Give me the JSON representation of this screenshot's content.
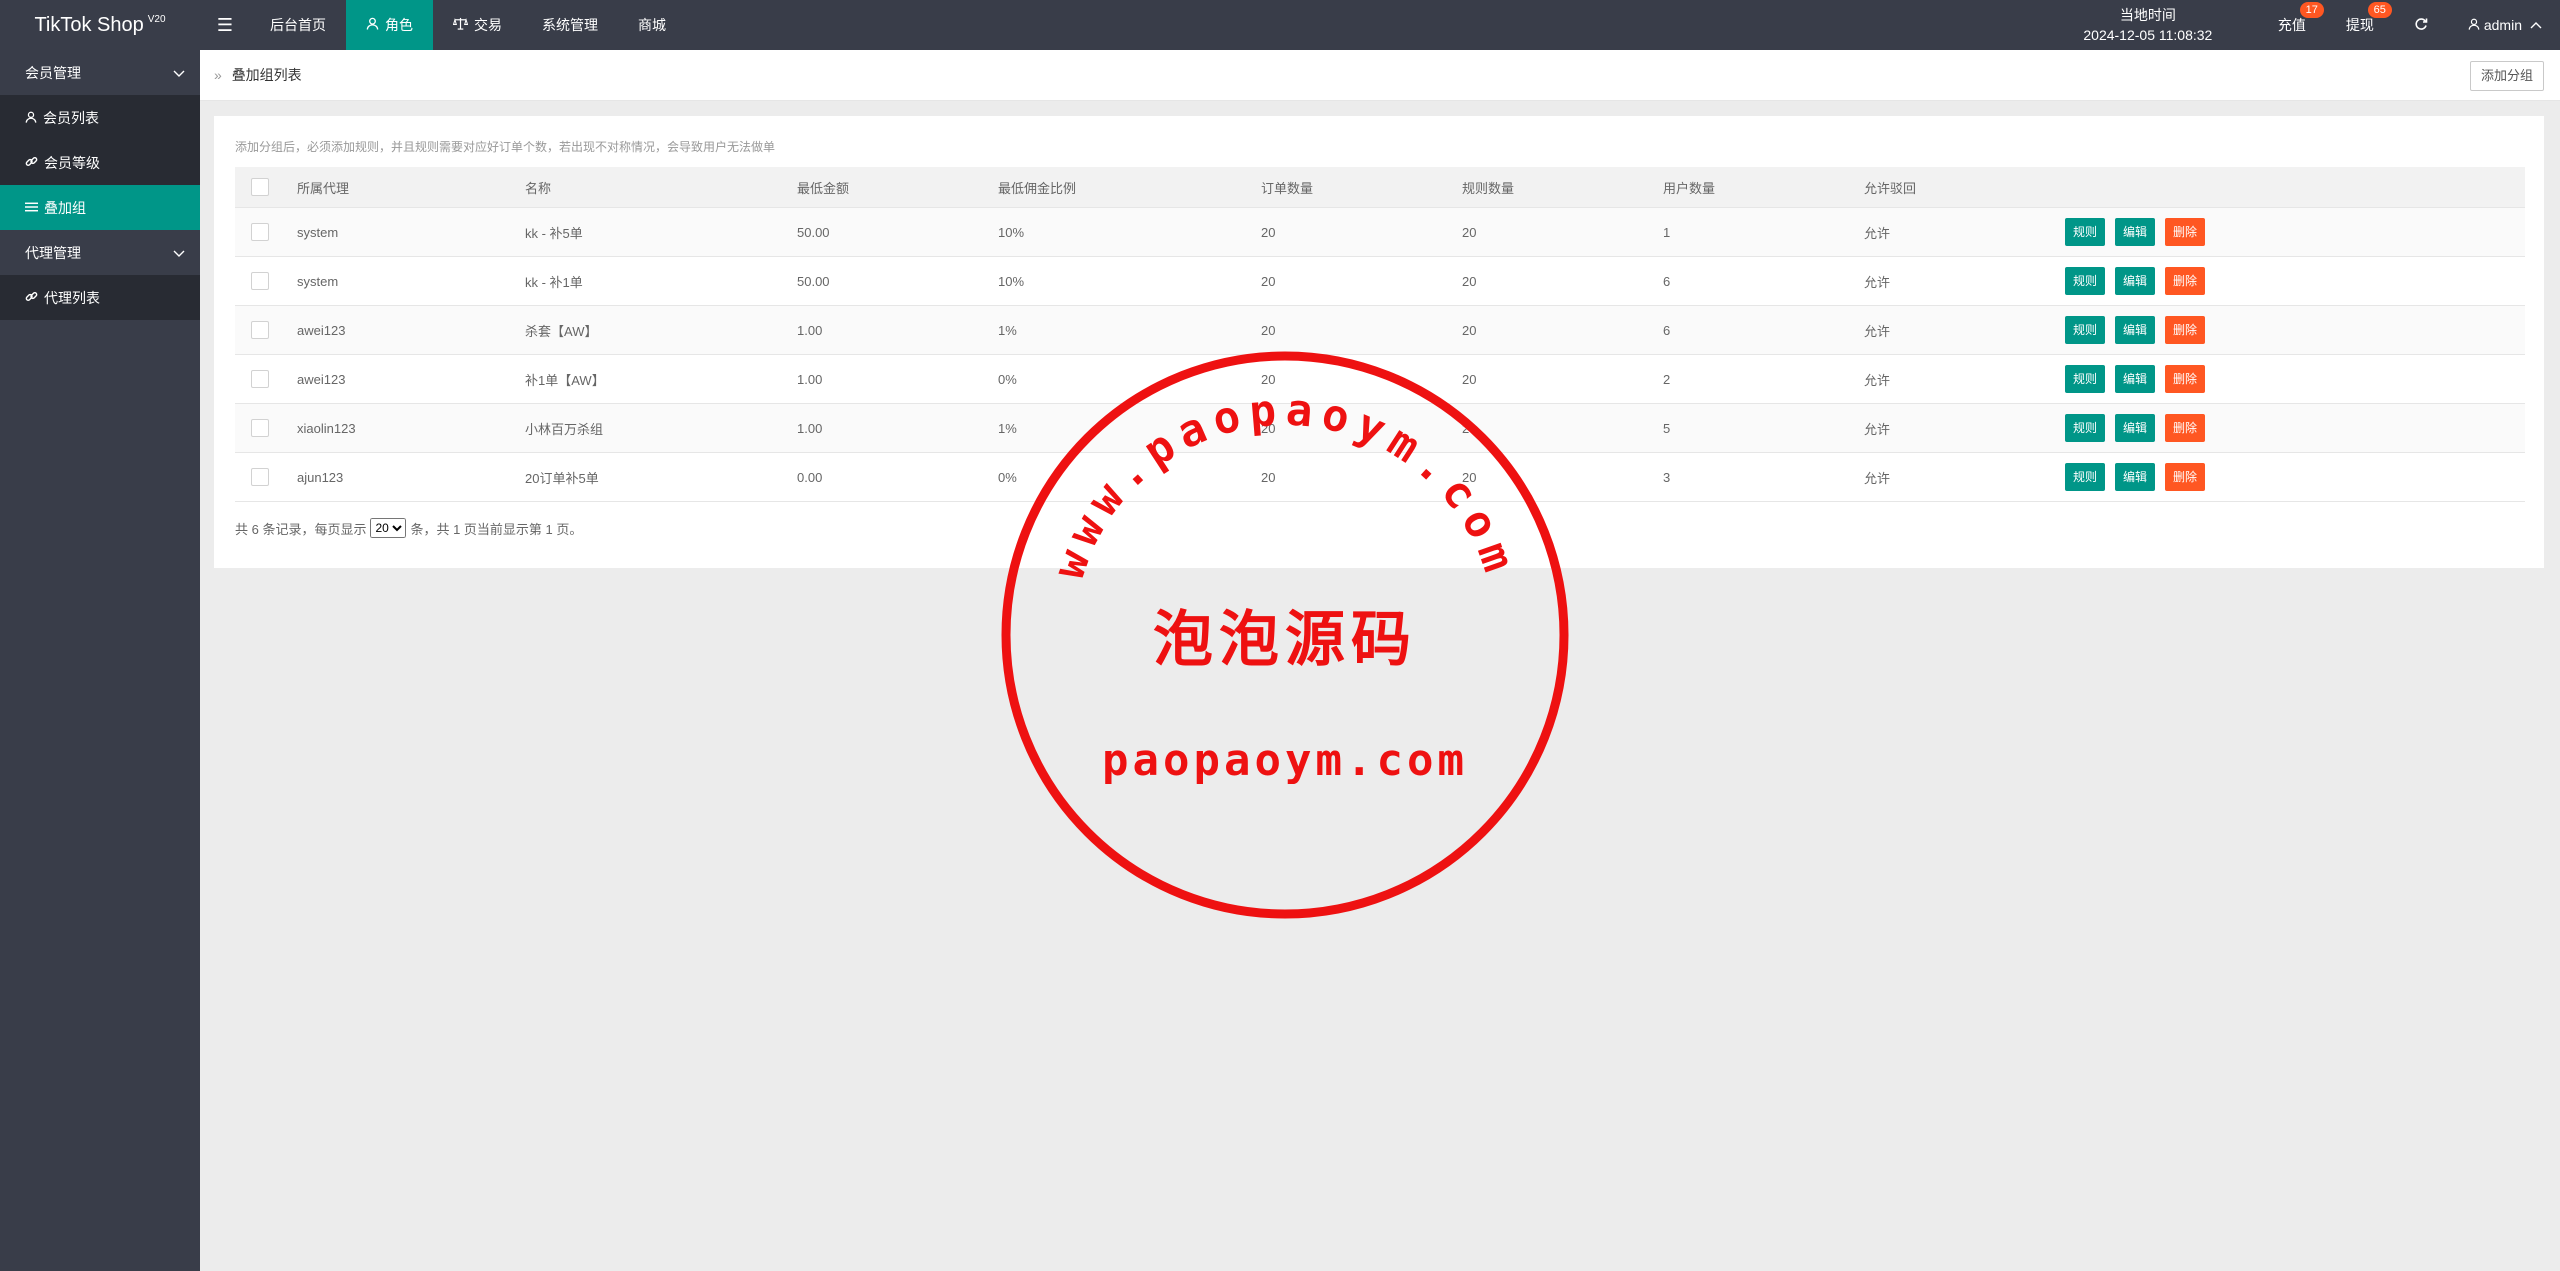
{
  "app": {
    "logo": "TikTok Shop",
    "version": "V20"
  },
  "nav": {
    "items": [
      {
        "label": "后台首页",
        "icon": "",
        "active": false
      },
      {
        "label": "角色",
        "icon": "user-icon",
        "active": true
      },
      {
        "label": "交易",
        "icon": "scale-icon",
        "active": false
      },
      {
        "label": "系统管理",
        "icon": "",
        "active": false
      },
      {
        "label": "商城",
        "icon": "",
        "active": false
      }
    ]
  },
  "header": {
    "time_label": "当地时间",
    "time_value": "2024-12-05 11:08:32",
    "recharge": {
      "label": "充值",
      "badge": "17"
    },
    "withdraw": {
      "label": "提现",
      "badge": "65"
    },
    "user": "admin"
  },
  "sidebar": {
    "groups": [
      {
        "label": "会员管理",
        "children": [
          {
            "label": "会员列表",
            "icon": "user-icon",
            "active": false
          },
          {
            "label": "会员等级",
            "icon": "link-icon",
            "active": false
          },
          {
            "label": "叠加组",
            "icon": "list-icon",
            "active": true
          }
        ]
      },
      {
        "label": "代理管理",
        "children": [
          {
            "label": "代理列表",
            "icon": "link-icon",
            "active": false
          }
        ]
      }
    ]
  },
  "page": {
    "breadcrumb": "叠加组列表",
    "add_button": "添加分组",
    "tip": "添加分组后，必须添加规则，并且规则需要对应好订单个数，若出现不对称情况，会导致用户无法做单"
  },
  "table": {
    "headers": [
      "所属代理",
      "名称",
      "最低金额",
      "最低佣金比例",
      "订单数量",
      "规则数量",
      "用户数量",
      "允许驳回"
    ],
    "rows": [
      [
        "system",
        "kk - 补5单",
        "50.00",
        "10%",
        "20",
        "20",
        "1",
        "允许"
      ],
      [
        "system",
        "kk - 补1单",
        "50.00",
        "10%",
        "20",
        "20",
        "6",
        "允许"
      ],
      [
        "awei123",
        "杀套【AW】",
        "1.00",
        "1%",
        "20",
        "20",
        "6",
        "允许"
      ],
      [
        "awei123",
        "补1单【AW】",
        "1.00",
        "0%",
        "20",
        "20",
        "2",
        "允许"
      ],
      [
        "xiaolin123",
        "小林百万杀组",
        "1.00",
        "1%",
        "20",
        "20",
        "5",
        "允许"
      ],
      [
        "ajun123",
        "20订单补5单",
        "0.00",
        "0%",
        "20",
        "20",
        "3",
        "允许"
      ]
    ],
    "ops": {
      "rules": "规则",
      "edit": "编辑",
      "delete": "删除"
    }
  },
  "pager": {
    "prefix": "共 6 条记录，每页显示",
    "page_size": "20",
    "suffix": "条，共 1 页当前显示第 1 页。"
  },
  "watermark": {
    "arc_text": "www.paopaoym.com",
    "center_text": "泡泡源码",
    "bottom_text": "paopaoym.com",
    "color": "#ee1111"
  },
  "colors": {
    "accent": "#009688",
    "danger": "#ff5722",
    "dark": "#393d49"
  }
}
